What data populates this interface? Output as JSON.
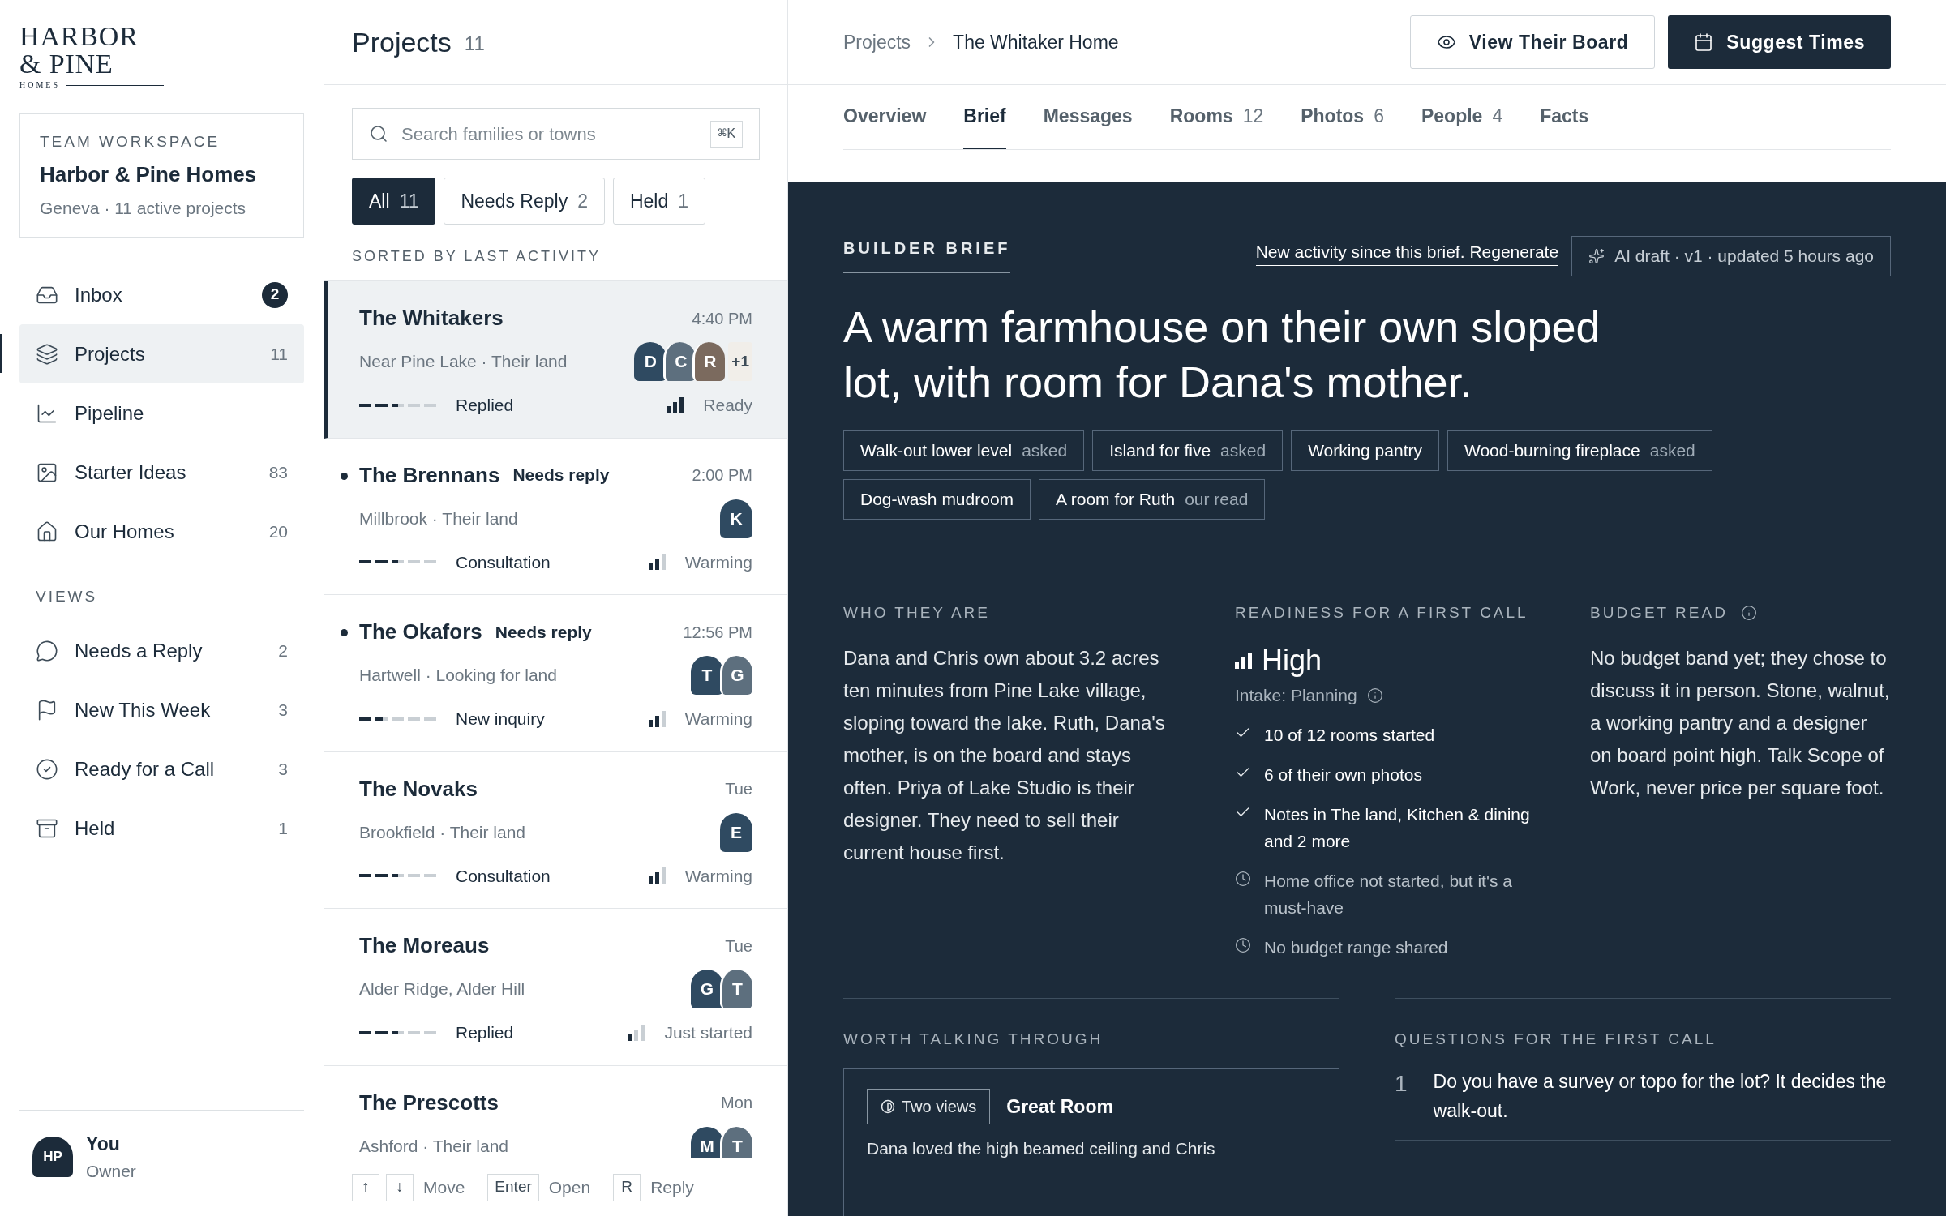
{
  "logo": {
    "line_1": "HARBOR",
    "line_2": "& PINE",
    "line_3": "HOMES"
  },
  "workspace": {
    "label": "TEAM WORKSPACE",
    "name": "Harbor & Pine Homes",
    "detail": "Geneva · 11 active projects"
  },
  "nav": [
    {
      "label": "Inbox",
      "count": "2",
      "kind": "badge",
      "selected": false
    },
    {
      "label": "Projects",
      "count": "11",
      "kind": "plain",
      "selected": true
    },
    {
      "label": "Pipeline",
      "selected": false
    },
    {
      "label": "Starter Ideas",
      "count": "83",
      "kind": "plain",
      "selected": false
    },
    {
      "label": "Our Homes",
      "count": "20",
      "kind": "plain",
      "selected": false
    }
  ],
  "views_heading": "VIEWS",
  "views": [
    {
      "label": "Needs a Reply",
      "count": "2",
      "selected": false
    },
    {
      "label": "New This Week",
      "count": "3",
      "selected": false
    },
    {
      "label": "Ready for a Call",
      "count": "3",
      "selected": false
    },
    {
      "label": "Held",
      "count": "1",
      "selected": false
    }
  ],
  "user": {
    "initials": "HP",
    "name": "You",
    "role": "Owner"
  },
  "list": {
    "title": "Projects",
    "count": "11",
    "search": {
      "placeholder": "Search families or towns",
      "shortcut": "⌘K"
    },
    "filters": [
      {
        "label": "All",
        "count": "11",
        "selected": true
      },
      {
        "label": "Needs Reply",
        "count": "2",
        "selected": false
      },
      {
        "label": "Held",
        "count": "1",
        "selected": false
      }
    ],
    "sort_label": "SORTED BY LAST ACTIVITY",
    "rows": [
      {
        "name": "The Whitakers",
        "time": "4:40 PM",
        "place": "Near Pine Lake · Their land",
        "selected": true,
        "unread": false,
        "avatars": [
          {
            "letter": "D",
            "color": "#2f4a61"
          },
          {
            "letter": "C",
            "color": "#5d6f7e"
          },
          {
            "letter": "R",
            "color": "#7b6a5e"
          }
        ],
        "more": "+1",
        "stage": {
          "level": 0.5,
          "label": "Replied"
        },
        "warmth": {
          "level": 1,
          "label": "Ready"
        }
      },
      {
        "name": "The Brennans",
        "tag": "Needs reply",
        "time": "2:00 PM",
        "place": "Millbrook · Their land",
        "selected": false,
        "unread": true,
        "avatars": [
          {
            "letter": "K",
            "color": "#2f4a61"
          }
        ],
        "stage": {
          "level": 0.5,
          "label": "Consultation"
        },
        "warmth": {
          "level": 0.67,
          "label": "Warming"
        }
      },
      {
        "name": "The Okafors",
        "tag": "Needs reply",
        "time": "12:56 PM",
        "place": "Hartwell · Looking for land",
        "selected": false,
        "unread": true,
        "avatars": [
          {
            "letter": "T",
            "color": "#2f4a61"
          },
          {
            "letter": "G",
            "color": "#5d6f7e"
          }
        ],
        "stage": {
          "level": 0.3,
          "label": "New inquiry"
        },
        "warmth": {
          "level": 0.67,
          "label": "Warming"
        }
      },
      {
        "name": "The Novaks",
        "time": "Tue",
        "place": "Brookfield · Their land",
        "selected": false,
        "unread": false,
        "avatars": [
          {
            "letter": "E",
            "color": "#2f4a61"
          }
        ],
        "stage": {
          "level": 0.5,
          "label": "Consultation"
        },
        "warmth": {
          "level": 0.67,
          "label": "Warming"
        }
      },
      {
        "name": "The Moreaus",
        "time": "Tue",
        "place": "Alder Ridge, Alder Hill",
        "selected": false,
        "unread": false,
        "avatars": [
          {
            "letter": "G",
            "color": "#2f4a61"
          },
          {
            "letter": "T",
            "color": "#5d6f7e"
          }
        ],
        "stage": {
          "level": 0.5,
          "label": "Replied"
        },
        "warmth": {
          "level": 0.33,
          "label": "Just started"
        }
      },
      {
        "name": "The Prescotts",
        "time": "Mon",
        "place": "Ashford · Their land",
        "selected": false,
        "unread": false,
        "avatars": [
          {
            "letter": "M",
            "color": "#2f4a61"
          },
          {
            "letter": "T",
            "color": "#5d6f7e"
          }
        ]
      }
    ],
    "footer": [
      {
        "keys": [
          "↑",
          "↓"
        ],
        "label": "Move"
      },
      {
        "keys": [
          "Enter"
        ],
        "label": "Open"
      },
      {
        "keys": [
          "R"
        ],
        "label": "Reply"
      }
    ]
  },
  "breadcrumb": [
    "Projects",
    "The Whitaker Home"
  ],
  "actions": [
    {
      "label": "View Their Board",
      "kind": "outline"
    },
    {
      "label": "Suggest Times",
      "kind": "solid"
    }
  ],
  "tabs": [
    {
      "label": "Overview",
      "selected": false
    },
    {
      "label": "Brief",
      "selected": true
    },
    {
      "label": "Messages",
      "selected": false
    },
    {
      "label": "Rooms",
      "count": "12",
      "selected": false
    },
    {
      "label": "Photos",
      "count": "6",
      "selected": false
    },
    {
      "label": "People",
      "count": "4",
      "selected": false
    },
    {
      "label": "Facts",
      "selected": false
    }
  ],
  "brief": {
    "label": "BUILDER BRIEF",
    "notice": "New activity since this brief. Regenerate",
    "draft": "AI draft · v1 · updated 5 hours ago",
    "headline": "A warm farmhouse on their own sloped lot, with room for Dana's mother.",
    "chips": [
      {
        "label": "Walk-out lower level",
        "note": "asked"
      },
      {
        "label": "Island for five",
        "note": "asked"
      },
      {
        "label": "Working pantry"
      },
      {
        "label": "Wood-burning fireplace",
        "note": "asked"
      },
      {
        "label": "Dog-wash mudroom"
      },
      {
        "label": "A room for Ruth",
        "note": "our read"
      }
    ],
    "who": {
      "heading": "WHO THEY ARE",
      "text": "Dana and Chris own about 3.2 acres ten minutes from Pine Lake village, sloping toward the lake. Ruth, Dana's mother, is on the board and stays often. Priya of Lake Studio is their designer. They need to sell their current house first."
    },
    "readiness": {
      "heading": "READINESS FOR A FIRST CALL",
      "value": "High",
      "level": 1,
      "intake": "Intake: Planning",
      "items": [
        {
          "kind": "done",
          "text": "10 of 12 rooms started"
        },
        {
          "kind": "done",
          "text": "6 of their own photos"
        },
        {
          "kind": "done",
          "text": "Notes in The land, Kitchen & dining and 2 more"
        },
        {
          "kind": "pending",
          "text": "Home office not started, but it's a must-have"
        },
        {
          "kind": "pending",
          "text": "No budget range shared"
        }
      ]
    },
    "budget": {
      "heading": "BUDGET READ",
      "text": "No budget band yet; they chose to discuss it in person. Stone, walnut, a working pantry and a designer on board point high. Talk Scope of Work, never price per square foot."
    },
    "worth": {
      "heading": "WORTH TALKING THROUGH",
      "tag": "Two views",
      "title": "Great Room",
      "text": "Dana loved the high beamed ceiling and Chris"
    },
    "questions": {
      "heading": "QUESTIONS FOR THE FIRST CALL",
      "items": [
        {
          "number": "1",
          "text": "Do you have a survey or topo for the lot? It decides the walk-out."
        }
      ]
    }
  }
}
